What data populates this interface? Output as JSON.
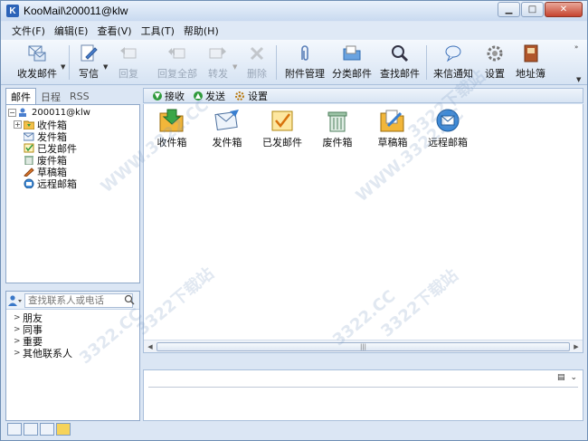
{
  "window": {
    "title": "KooMail\\200011@klw",
    "app_icon_letter": "K"
  },
  "menubar": {
    "items": [
      "文件(F)",
      "编辑(E)",
      "查看(V)",
      "工具(T)",
      "帮助(H)"
    ]
  },
  "toolbar": {
    "send_receive": "收发邮件",
    "compose": "写信",
    "reply": "回复",
    "reply_all": "回复全部",
    "forward": "转发",
    "delete": "删除",
    "attachments": "附件管理",
    "classify": "分类邮件",
    "find": "查找邮件",
    "notify": "来信通知",
    "settings": "设置",
    "address_book": "地址簿"
  },
  "left_tabs": [
    "邮件",
    "日程",
    "RSS"
  ],
  "tree": {
    "account": "200011@klw",
    "folders": [
      "收件箱",
      "发件箱",
      "已发邮件",
      "废件箱",
      "草稿箱",
      "远程邮箱"
    ]
  },
  "contacts": {
    "search_placeholder": "查找联系人或电话",
    "groups": [
      "朋友",
      "同事",
      "重要",
      "其他联系人"
    ]
  },
  "sub_toolbar": {
    "receive": "接收",
    "send": "发送",
    "settings": "设置"
  },
  "folder_view": [
    "收件箱",
    "发件箱",
    "已发邮件",
    "废件箱",
    "草稿箱",
    "远程邮箱"
  ],
  "watermark_text": "3322.CC",
  "watermark_text_alt": "3322下载站",
  "watermark_text_www": "WWW.3322.CC"
}
